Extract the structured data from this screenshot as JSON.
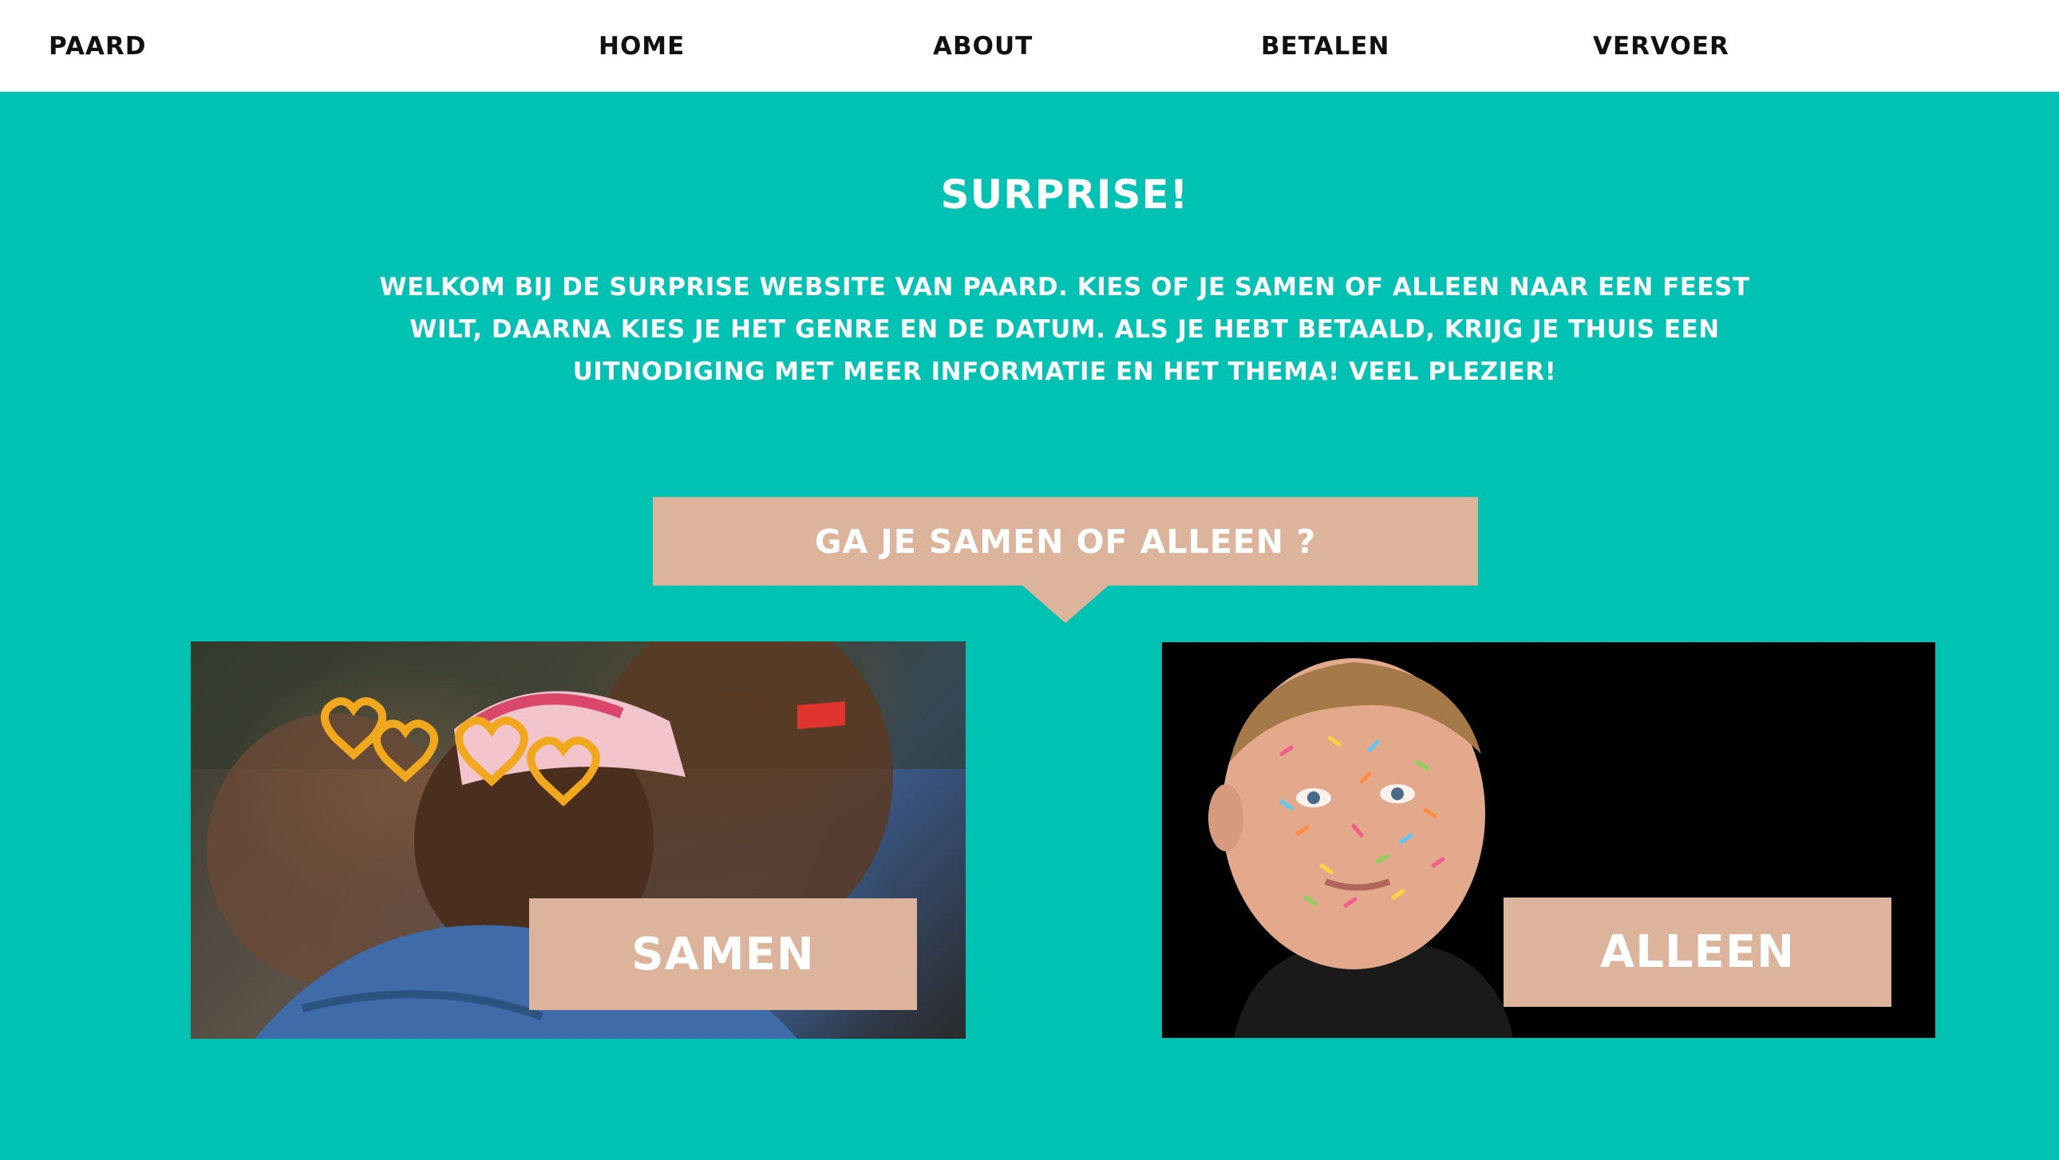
{
  "nav": {
    "brand": "PAARD",
    "links": [
      "HOME",
      "ABOUT",
      "BETALEN",
      "VERVOER"
    ]
  },
  "hero": {
    "title": "SURPRISE!",
    "intro": "WELKOM BIJ DE SURPRISE WEBSITE VAN PAARD. KIES OF JE SAMEN OF ALLEEN NAAR EEN FEEST WILT, DAARNA KIES JE HET GENRE EN DE DATUM. ALS JE HEBT BETAALD, KRIJG JE THUIS EEN UITNODIGING MET MEER INFORMATIE EN HET THEMA! VEEL PLEZIER!"
  },
  "choice": {
    "question": "GA JE SAMEN OF ALLEEN ?",
    "options": [
      {
        "label": "SAMEN"
      },
      {
        "label": "ALLEEN"
      }
    ]
  },
  "colors": {
    "background": "#00c2b2",
    "accent": "#dbb49b",
    "text_light": "#ffffff",
    "text_dark": "#111111"
  }
}
